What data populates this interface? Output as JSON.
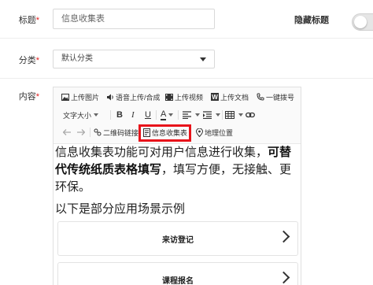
{
  "form": {
    "title_label": "标题",
    "title_required": "*",
    "title_value": "信息收集表",
    "hide_title_label": "隐藏标题",
    "hide_title_enabled": false,
    "category_label": "分类",
    "category_required": "*",
    "category_value": "默认分类",
    "content_label": "内容",
    "content_required": "*"
  },
  "toolbar": {
    "upload_image": "上传图片",
    "voice_upload": "语音上传/合成",
    "upload_video": "上传视频",
    "upload_doc": "上传文档",
    "one_click_dial": "一键拨号",
    "font_size": "文字大小",
    "bold": "B",
    "italic": "I",
    "underline": "U",
    "font_color": "A",
    "qr_link": "二维码链接",
    "info_collect": "信息收集表",
    "geo_location": "地理位置"
  },
  "content": {
    "para1_text": "信息收集表功能可对用户信息进行收集，",
    "para1_bold": "可替代传统纸质表格填写",
    "para1_tail": "，填写方便，无接触、更环保。",
    "para2": "以下是部分应用场景示例",
    "cards": [
      {
        "label": "来访登记"
      },
      {
        "label": "课程报名"
      }
    ]
  },
  "colors": {
    "highlight": "#e8131a",
    "required": "#e02020"
  },
  "icons": [
    "image-icon",
    "voice-icon",
    "video-icon",
    "word-doc-icon",
    "phone-icon",
    "align-left-icon",
    "indent-icon",
    "table-icon",
    "link-icon",
    "undo-icon",
    "redo-icon",
    "qr-link-icon",
    "form-icon",
    "location-pin-icon",
    "chevron-right-icon"
  ]
}
